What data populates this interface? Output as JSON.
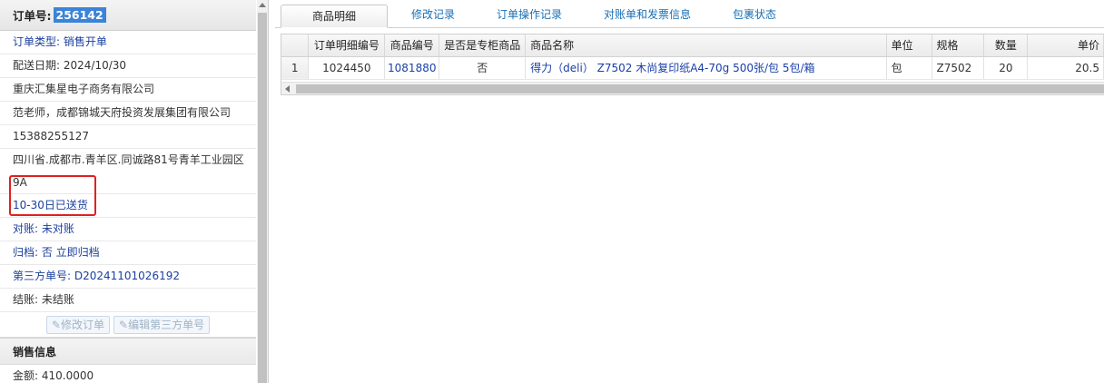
{
  "order": {
    "label": "订单号:",
    "number": "256142",
    "type": "订单类型: 销售开单",
    "delivery_date": "配送日期: 2024/10/30",
    "company": "重庆汇集星电子商务有限公司",
    "contact": "范老师，成都锦城天府投资发展集团有限公司",
    "phone": "15388255127",
    "address": "四川省.成都市.青羊区.同诚路81号青羊工业园区9A",
    "delivery_status": "10-30日已送货",
    "reconcile": "对账: 未对账",
    "archive": "归档:  否 立即归档",
    "third_party": "第三方单号:  D20241101026192",
    "settlement": "结账: 未结账",
    "buttons": {
      "edit_order": "修改订单",
      "edit_third": "编辑第三方单号"
    }
  },
  "sales": {
    "title": "销售信息",
    "amount": "金额: 410.0000"
  },
  "tabs": [
    "商品明细",
    "修改记录",
    "订单操作记录",
    "对账单和发票信息",
    "包裹状态"
  ],
  "grid": {
    "headers": [
      "订单明细编号",
      "商品编号",
      "是否是专柜商品",
      "商品名称",
      "单位",
      "规格",
      "数量",
      "单价"
    ],
    "rows": [
      {
        "rownum": "1",
        "detail_id": "1024450",
        "product_id": "1081880",
        "counter": "否",
        "name": "得力（deli） Z7502 木尚复印纸A4-70g 500张/包 5包/箱",
        "unit": "包",
        "spec": "Z7502",
        "qty": "20",
        "price": "20.5"
      }
    ]
  },
  "colors": {
    "accent": "#1a3f9e",
    "highlight": "#e02020",
    "selected_bg": "#3b84d8"
  }
}
